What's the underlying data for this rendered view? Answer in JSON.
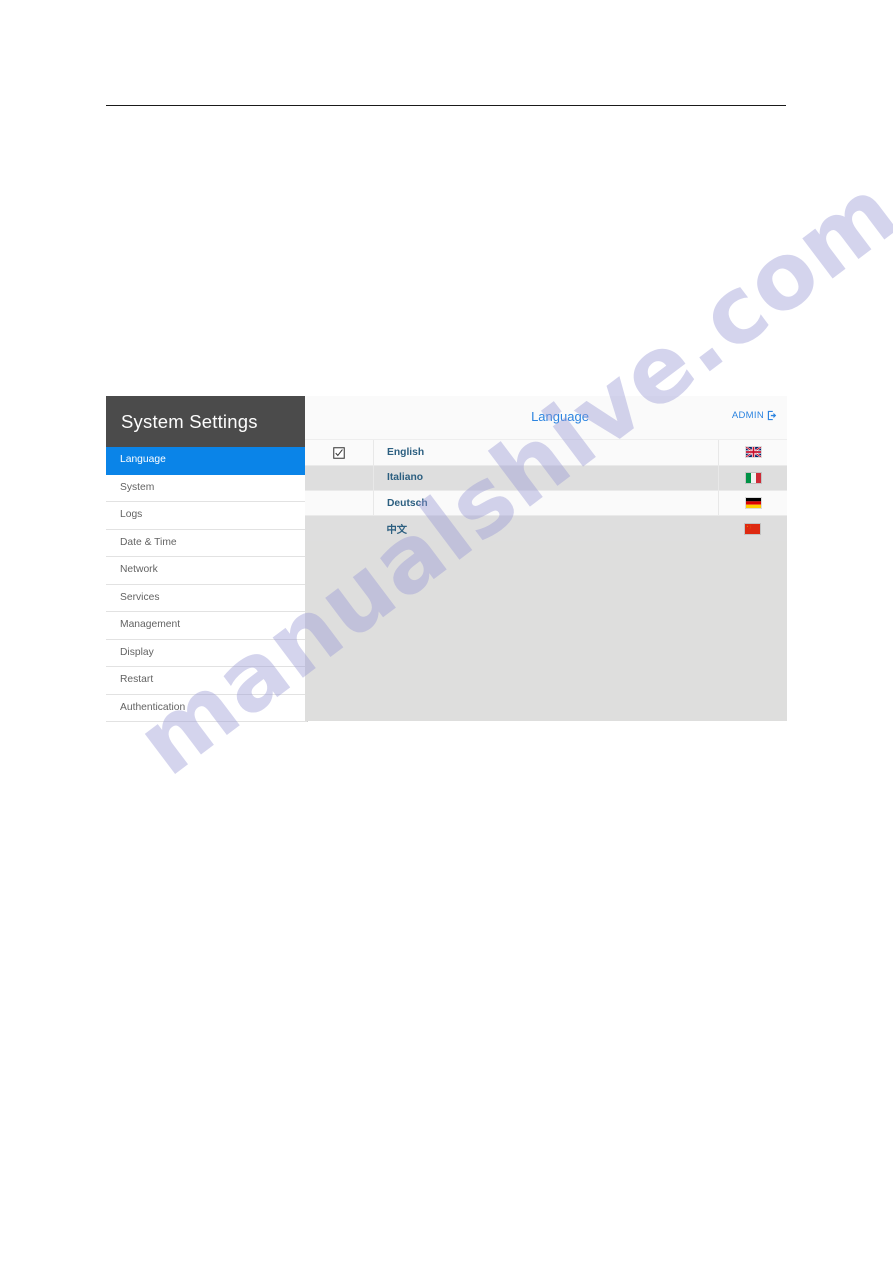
{
  "document": {
    "has_top_rule": true,
    "watermark_text": "manualshive.com"
  },
  "app": {
    "sidebar": {
      "title": "System Settings",
      "items": [
        {
          "label": "Language",
          "active": true
        },
        {
          "label": "System",
          "active": false
        },
        {
          "label": "Logs",
          "active": false
        },
        {
          "label": "Date & Time",
          "active": false
        },
        {
          "label": "Network",
          "active": false
        },
        {
          "label": "Services",
          "active": false
        },
        {
          "label": "Management",
          "active": false
        },
        {
          "label": "Display",
          "active": false
        },
        {
          "label": "Restart",
          "active": false
        },
        {
          "label": "Authentication",
          "active": false
        }
      ]
    },
    "content": {
      "title": "Language",
      "admin": {
        "label": "ADMIN",
        "icon": "logout-icon"
      },
      "languages": [
        {
          "name": "English",
          "selected": true,
          "flag": "flag-uk",
          "flag_name": "united-kingdom-flag-icon"
        },
        {
          "name": "Italiano",
          "selected": false,
          "flag": "flag-italy",
          "flag_name": "italy-flag-icon"
        },
        {
          "name": "Deutsch",
          "selected": false,
          "flag": "flag-germany",
          "flag_name": "germany-flag-icon"
        },
        {
          "name": "中文",
          "selected": false,
          "flag": "flag-china",
          "flag_name": "china-flag-icon"
        }
      ]
    }
  },
  "colors": {
    "accent_blue": "#0a84e8",
    "link_blue": "#2c84e0",
    "header_dark": "#4b4b4b",
    "panel_gray": "#dededd",
    "row_light": "#fafafa",
    "row_dark": "#dedede",
    "lang_text": "#2c5f80"
  }
}
